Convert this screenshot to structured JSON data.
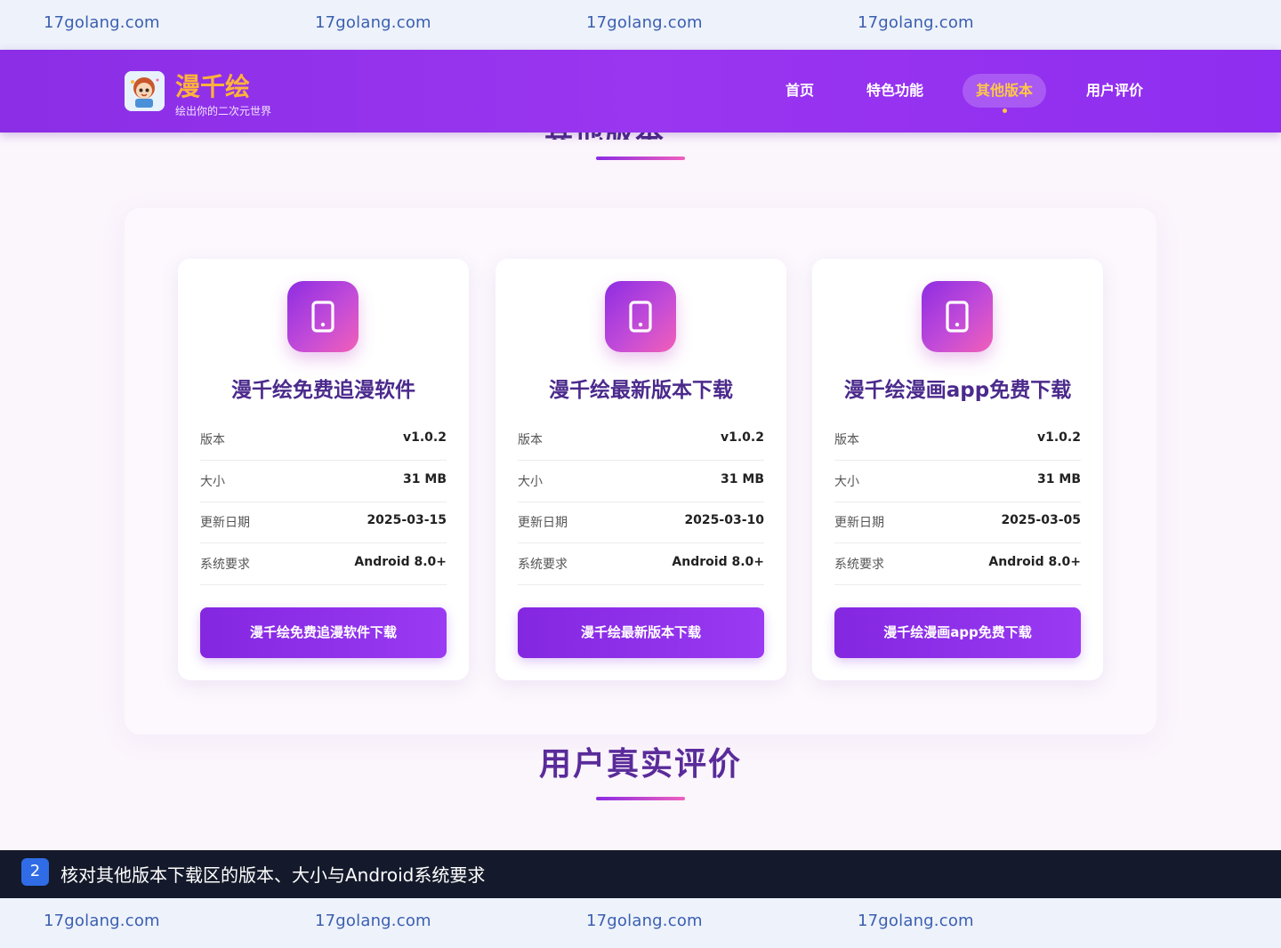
{
  "watermark": {
    "text": "17golang.com"
  },
  "header": {
    "app_name": "漫千绘",
    "tagline": "绘出你的二次元世界",
    "nav": [
      {
        "label": "首页"
      },
      {
        "label": "特色功能"
      },
      {
        "label": "其他版本",
        "active": true
      },
      {
        "label": "用户评价"
      }
    ]
  },
  "colors": {
    "brand_purple": "#8b2ee6",
    "accent_yellow": "#ffc845",
    "title_purple": "#4b2a8c",
    "gradient_pink": "#f25fb8"
  },
  "versions": {
    "spec_labels": {
      "version": "版本",
      "size": "大小",
      "date": "更新日期",
      "requirement": "系统要求"
    },
    "cards": [
      {
        "icon": "mobile-phone-icon",
        "title": "漫千绘免费追漫软件",
        "version": "v1.0.2",
        "size": "31 MB",
        "date": "2025-03-15",
        "requirement": "Android 8.0+",
        "button": "漫千绘免费追漫软件下载"
      },
      {
        "icon": "mobile-phone-icon",
        "title": "漫千绘最新版本下载",
        "version": "v1.0.2",
        "size": "31 MB",
        "date": "2025-03-10",
        "requirement": "Android 8.0+",
        "button": "漫千绘最新版本下载"
      },
      {
        "icon": "mobile-phone-icon",
        "title": "漫千绘漫画app免费下载",
        "version": "v1.0.2",
        "size": "31 MB",
        "date": "2025-03-05",
        "requirement": "Android 8.0+",
        "button": "漫千绘漫画app免费下载"
      }
    ]
  },
  "reviews": {
    "title": "用户真实评价"
  },
  "instruction": {
    "step": "2",
    "text": "核对其他版本下载区的版本、大小与Android系统要求"
  }
}
